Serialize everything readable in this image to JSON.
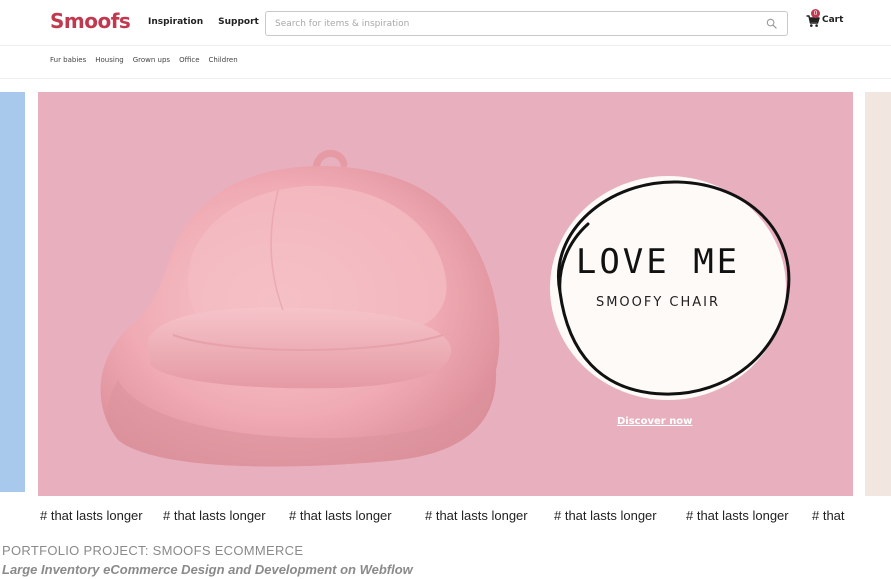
{
  "header": {
    "logo": "Smoofs",
    "nav": [
      "Inspiration",
      "Support"
    ],
    "search_placeholder": "Search for items & inspiration",
    "cart_label": "Cart",
    "cart_count": "0"
  },
  "subnav": [
    "Fur babies",
    "Housing",
    "Grown ups",
    "Office",
    "Children"
  ],
  "hero": {
    "title": "LOVE ME",
    "subtitle": "SMOOFY CHAIR",
    "cta": "Discover now",
    "background_color": "#e8afbe"
  },
  "marquee": [
    "# that lasts longer",
    "# that lasts longer",
    "# that lasts longer",
    "# that lasts longer",
    "# that lasts longer",
    "# that lasts longer",
    "# that"
  ],
  "caption": {
    "line1": "PORTFOLIO PROJECT:  SMOOFS ECOMMERCE",
    "line2": "Large Inventory eCommerce  Design and Development on Webflow"
  },
  "colors": {
    "brand": "#c0394f",
    "prev_slide": "#a8c9ec",
    "next_slide": "#f1e6e0"
  }
}
